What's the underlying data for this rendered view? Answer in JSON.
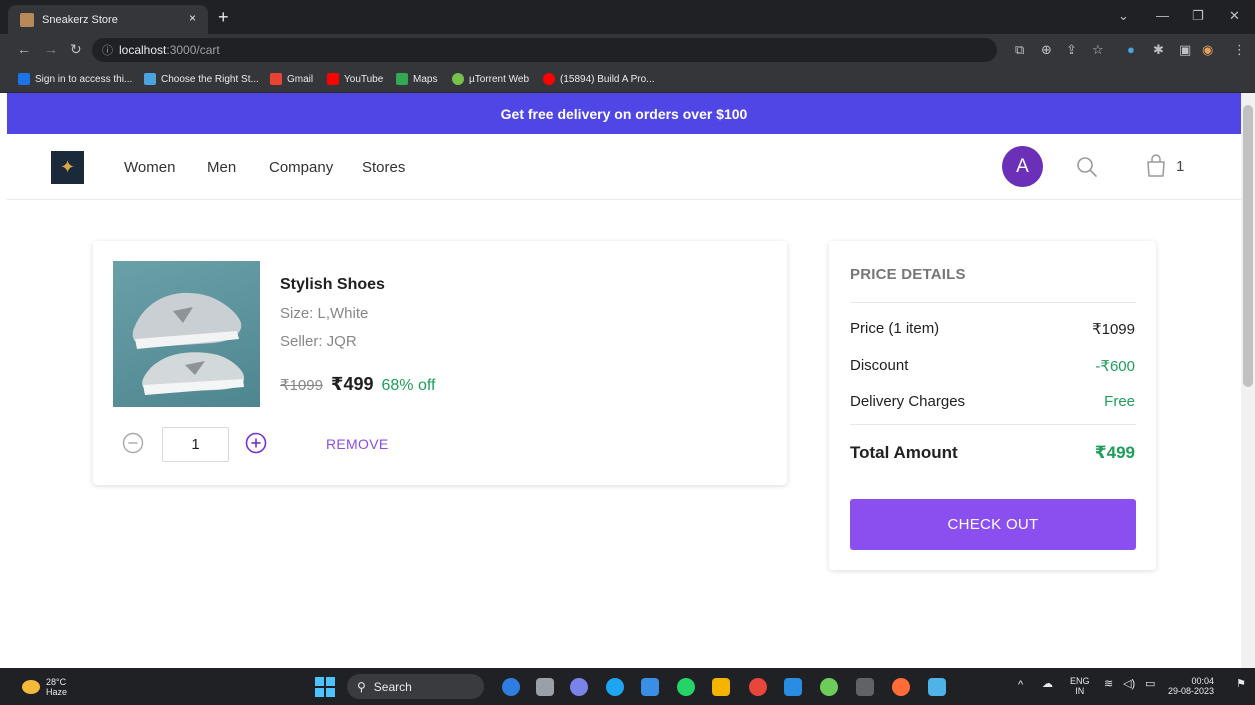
{
  "browser": {
    "tab_title": "Sneakerz Store",
    "tab_close": "×",
    "new_tab": "+",
    "url_host": "localhost",
    "url_path": ":3000/cart",
    "bookmarks": [
      {
        "label": "Sign in to access thi...",
        "color": "#1a73e8"
      },
      {
        "label": "Choose the Right St...",
        "color": "#4aa3df"
      },
      {
        "label": "Gmail",
        "color": "#ea4335"
      },
      {
        "label": "YouTube",
        "color": "#ff0000"
      },
      {
        "label": "Maps",
        "color": "#34a853"
      },
      {
        "label": "µTorrent Web",
        "color": "#78c04a"
      },
      {
        "label": "(15894) Build A Pro...",
        "color": "#ff0000"
      }
    ]
  },
  "promo": {
    "text": "Get free delivery on orders over $100"
  },
  "nav": {
    "links": [
      "Women",
      "Men",
      "Company",
      "Stores"
    ],
    "avatar_initial": "A",
    "cart_count": "1"
  },
  "cart_item": {
    "name": "Stylish Shoes",
    "size": "Size: L,White",
    "seller": "Seller: JQR",
    "old_price": "₹1099",
    "price": "₹499",
    "discount": "68% off",
    "quantity": "1",
    "remove_label": "REMOVE"
  },
  "price_details": {
    "title": "PRICE DETAILS",
    "rows": [
      {
        "label": "Price (1 item)",
        "value": "₹1099",
        "color": "#212121"
      },
      {
        "label": "Discount",
        "value": "-₹600",
        "color": "#1e9e5a"
      },
      {
        "label": "Delivery Charges",
        "value": "Free",
        "color": "#1e9e5a"
      }
    ],
    "total_label": "Total Amount",
    "total_value": "₹499",
    "checkout_label": "CHECK OUT"
  },
  "taskbar": {
    "weather_temp": "28°C",
    "weather_desc": "Haze",
    "search_label": "Search",
    "lang": "ENG",
    "region": "IN",
    "time": "00:04",
    "date": "29-08-2023"
  },
  "colors": {
    "promo_bg": "#5045e5",
    "accent_purple": "#8b4ff0",
    "avatar_bg": "#6b2fb8",
    "success_green": "#1e9e5a"
  }
}
